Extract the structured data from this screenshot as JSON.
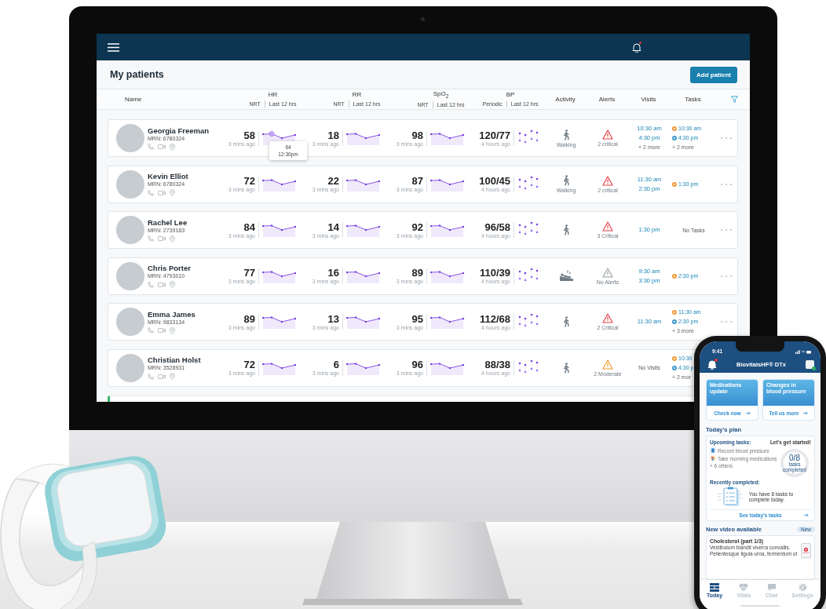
{
  "app": {
    "title": "My patients",
    "add_button": "Add patient",
    "unread": true
  },
  "columns": [
    {
      "title": "Name"
    },
    {
      "title": "HR",
      "sub": [
        "NRT",
        "Last 12 hrs"
      ]
    },
    {
      "title": "RR",
      "sub": [
        "NRT",
        "Last 12 hrs"
      ]
    },
    {
      "title": "SpO$_{2}$",
      "sub": [
        "NRT",
        "Last 12 hrs"
      ]
    },
    {
      "title": "BP",
      "sub": [
        "Periodic",
        "Last 12 hrs"
      ]
    },
    {
      "title": "Activity"
    },
    {
      "title": "Alerts"
    },
    {
      "title": "Visits"
    },
    {
      "title": "Tasks"
    }
  ],
  "patients": [
    {
      "name": "Georgia Freeman",
      "mrn": "MRN: 6780324",
      "hr": {
        "value": "58",
        "ago": "3 mins ago"
      },
      "rr": {
        "value": "18",
        "ago": "3 mins ago"
      },
      "spo2": {
        "value": "98",
        "ago": "3 mins ago"
      },
      "bp": {
        "value": "120/77",
        "ago": "4 hours ago"
      },
      "tooltip": {
        "value": "64",
        "time": "12:30pm"
      },
      "activity": {
        "kind": "walking",
        "label": "Walking"
      },
      "alert": {
        "kind": "critical",
        "text": "2 critical"
      },
      "visits": {
        "items": [
          "10:30 am",
          "4:30 pm"
        ],
        "more": "+ 2 more"
      },
      "tasks": {
        "items": [
          {
            "time": "10:30 am",
            "color": "#f29a38"
          },
          {
            "time": "4:30 pm",
            "color": "#3f98c8"
          }
        ],
        "more": "+ 2 more"
      },
      "menu": true
    },
    {
      "name": "Kevin Elliot",
      "mrn": "MRN: 6780324",
      "hr": {
        "value": "72",
        "ago": "3 mins ago"
      },
      "rr": {
        "value": "22",
        "ago": "3 mins ago"
      },
      "spo2": {
        "value": "87",
        "ago": "3 mins ago"
      },
      "bp": {
        "value": "100/45",
        "ago": "4 hours ago"
      },
      "activity": {
        "kind": "walking",
        "label": "Walking"
      },
      "alert": {
        "kind": "critical",
        "text": "2 critical"
      },
      "visits": {
        "items": [
          "11:30 am",
          "2:30 pm"
        ]
      },
      "tasks": {
        "items": [
          {
            "time": "1:30 pm",
            "color": "#f29a38"
          }
        ]
      },
      "menu": true
    },
    {
      "name": "Rachel Lee",
      "mrn": "MRN: 2739183",
      "hr": {
        "value": "84",
        "ago": "3 mins ago"
      },
      "rr": {
        "value": "14",
        "ago": "3 mins ago"
      },
      "spo2": {
        "value": "92",
        "ago": "3 mins ago"
      },
      "bp": {
        "value": "96/58",
        "ago": "4 hours ago"
      },
      "activity": {
        "kind": "walking"
      },
      "alert": {
        "kind": "critical",
        "text": "3 Critical"
      },
      "visits": {
        "items": [
          "1:30 pm"
        ]
      },
      "tasks": {
        "empty": "No Tasks"
      },
      "menu": true
    },
    {
      "name": "Chris Porter",
      "mrn": "MRN: 4793010",
      "hr": {
        "value": "77",
        "ago": "3 mins ago"
      },
      "rr": {
        "value": "16",
        "ago": "3 mins ago"
      },
      "spo2": {
        "value": "89",
        "ago": "3 mins ago"
      },
      "bp": {
        "value": "110/39",
        "ago": "4 hours ago"
      },
      "activity": {
        "kind": "sleeping"
      },
      "alert": {
        "kind": "none",
        "text": "No Alerts"
      },
      "visits": {
        "items": [
          "9:30 am",
          "3:30 pm"
        ]
      },
      "tasks": {
        "items": [
          {
            "time": "2:30 pm",
            "color": "#f29a38"
          }
        ]
      },
      "menu": true
    },
    {
      "name": "Emma James",
      "mrn": "MRN: 9833134",
      "hr": {
        "value": "89",
        "ago": "3 mins ago"
      },
      "rr": {
        "value": "13",
        "ago": "3 mins ago"
      },
      "spo2": {
        "value": "95",
        "ago": "3 mins ago"
      },
      "bp": {
        "value": "112/68",
        "ago": "4 hours ago"
      },
      "activity": {
        "kind": "walking"
      },
      "alert": {
        "kind": "critical",
        "text": "2 Critical"
      },
      "visits": {
        "items": [
          "11:30 am"
        ]
      },
      "tasks": {
        "items": [
          {
            "time": "11:30 am",
            "color": "#f29a38"
          },
          {
            "time": "2:30 pm",
            "color": "#3f98c8"
          }
        ],
        "more": "+ 3 more"
      },
      "menu": true
    },
    {
      "name": "Christian Holst",
      "mrn": "MRN: 3528931",
      "hr": {
        "value": "72",
        "ago": "3 mins ago"
      },
      "rr": {
        "value": "6",
        "ago": "3 mins ago"
      },
      "spo2": {
        "value": "96",
        "ago": "3 mins ago"
      },
      "bp": {
        "value": "88/38",
        "ago": "4 hours ago"
      },
      "activity": {
        "kind": "walking"
      },
      "alert": {
        "kind": "moderate",
        "text": "2 Moderate"
      },
      "visits": {
        "empty": "No Visits"
      },
      "tasks": {
        "items": [
          {
            "time": "10:30",
            "color": "#f29a38"
          },
          {
            "time": "4:30 p",
            "color": "#3f98c8"
          }
        ],
        "more": "+ 2 mor"
      },
      "menu": false
    }
  ],
  "phone": {
    "time": "9:41",
    "title": "BiovitalsHF® DTx",
    "unread": true,
    "cards": [
      {
        "title": "Medications update",
        "action": "Check now"
      },
      {
        "title": "Changes in blood pressure",
        "action": "Tell us more"
      }
    ],
    "plan": {
      "heading": "Today's plan",
      "upcoming_label": "Upcoming tasks:",
      "cta": "Let's get started!",
      "tasks": [
        {
          "kind": "measure",
          "text": "Record blood pressure"
        },
        {
          "kind": "medication",
          "text": "Take morning medications"
        }
      ],
      "others": "+ 6 others",
      "progress": "0/8",
      "progress_caption": "tasks completed",
      "level": 0,
      "recent_label": "Recently completed:",
      "recent_text": "You have 8 tasks to complete today.",
      "link": "See today's tasks"
    },
    "video": {
      "heading": "New video available",
      "badge": "New",
      "title": "Cholesterol (part 1/3)",
      "text": "Vestibulum blandit viverra convallis. Pellentesque ligula urna, fermentum ut"
    },
    "tabs": [
      {
        "kind": "today",
        "label": "Today",
        "selected": true
      },
      {
        "kind": "vitals",
        "label": "Vitals",
        "selected": false
      },
      {
        "kind": "chat",
        "label": "Chat",
        "selected": false
      },
      {
        "kind": "settings",
        "label": "Settings",
        "selected": false
      }
    ]
  }
}
